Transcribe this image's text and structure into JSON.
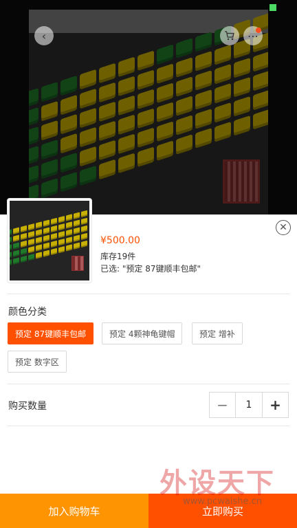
{
  "top_bar": {
    "back_icon": "chevron-left-icon",
    "cart_icon": "cart-icon",
    "more_icon": "more-icon"
  },
  "product": {
    "price": "¥500.00",
    "stock": "库存19件",
    "selected": "已选: \"预定 87键顺丰包邮\""
  },
  "options": {
    "title": "颜色分类",
    "items": [
      {
        "label": "预定 87键顺丰包邮",
        "active": true
      },
      {
        "label": "预定 4颗神龟键帽",
        "active": false
      },
      {
        "label": "预定 增补",
        "active": false
      },
      {
        "label": "预定 数字区",
        "active": false
      }
    ]
  },
  "quantity": {
    "label": "购买数量",
    "minus": "−",
    "value": "1",
    "plus": "+"
  },
  "watermark": {
    "text": "外设天下",
    "url": "www.pcwaishe.cn"
  },
  "actions": {
    "add_to_cart": "加入购物车",
    "buy_now": "立即购买"
  },
  "colors": {
    "accent": "#ff5000",
    "cart_button": "#ff9402"
  }
}
